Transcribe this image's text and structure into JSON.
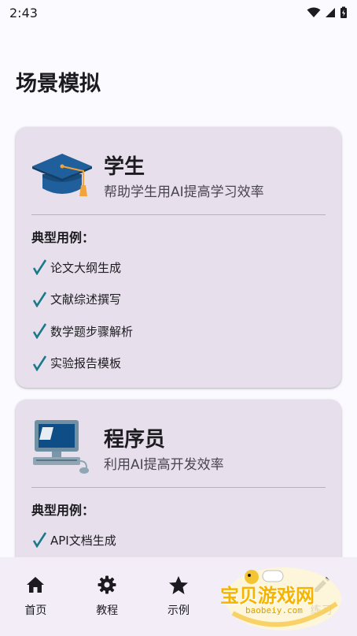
{
  "status_bar": {
    "time": "2:43"
  },
  "page_title": "场景模拟",
  "cards": [
    {
      "icon": "graduation-cap-icon",
      "title": "学生",
      "subtitle": "帮助学生用AI提高学习效率",
      "use_heading": "典型用例：",
      "use_cases": [
        "论文大纲生成",
        "文献综述撰写",
        "数学题步骤解析",
        "实验报告模板"
      ]
    },
    {
      "icon": "computer-icon",
      "title": "程序员",
      "subtitle": "利用AI提高开发效率",
      "use_heading": "典型用例：",
      "use_cases": [
        "API文档生成"
      ]
    }
  ],
  "bottom_nav": [
    {
      "icon": "home-icon",
      "label": "首页"
    },
    {
      "icon": "gear-icon",
      "label": "教程"
    },
    {
      "icon": "star-icon",
      "label": "示例"
    },
    {
      "icon": "scene-icon",
      "label": ""
    },
    {
      "icon": "pencil-icon",
      "label": "练习"
    }
  ],
  "watermark": {
    "text": "宝贝游戏网",
    "url": "baobeiy.com"
  },
  "colors": {
    "background": "#fbfaff",
    "card": "#e7e0ec",
    "nav": "#f2edf7",
    "check": "#1a7a88",
    "cap": "#1e5f9c"
  }
}
